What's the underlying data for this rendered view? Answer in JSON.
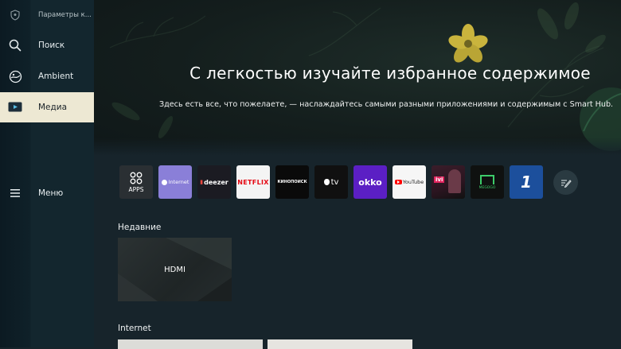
{
  "sidebar": {
    "items": [
      {
        "label": "Параметры к...",
        "icon": "shield-icon"
      },
      {
        "label": "Поиск",
        "icon": "search-icon"
      },
      {
        "label": "Ambient",
        "icon": "ambient-icon"
      },
      {
        "label": "Медиа",
        "icon": "media-icon",
        "active": true
      },
      {
        "label": "Меню",
        "icon": "menu-icon"
      }
    ]
  },
  "hero": {
    "title": "С легкостью изучайте избранное содержимое",
    "subtitle": "Здесь есть все, что пожелаете, — наслаждайтесь самыми разными приложениями и содержимым с Smart Hub."
  },
  "apps": [
    {
      "label": "APPS",
      "icon": "apps-grid-icon",
      "bg": "#2a2f33"
    },
    {
      "label": "Internet",
      "icon": "internet-icon",
      "bg": "#8a7fd8"
    },
    {
      "label": "deezer",
      "icon": "deezer-icon",
      "bg": "#1b1b22"
    },
    {
      "label": "NETFLIX",
      "icon": "netflix-icon",
      "bg": "#f4f4f4"
    },
    {
      "label": "КИНОПОИСК",
      "icon": "kinopoisk-icon",
      "bg": "#0a0a0a"
    },
    {
      "label": "tv",
      "icon": "apple-tv-icon",
      "bg": "#101010"
    },
    {
      "label": "okko",
      "icon": "okko-icon",
      "bg": "#5b1fc4"
    },
    {
      "label": "YouTube",
      "icon": "youtube-icon",
      "bg": "#f6f6f6"
    },
    {
      "label": "ivi",
      "icon": "ivi-icon",
      "bg": "#2b1520"
    },
    {
      "label": "MEGOGO",
      "icon": "megogo-icon",
      "bg": "#0f1110"
    },
    {
      "label": "1",
      "icon": "channel-one-icon",
      "bg": "#1c4f9c"
    }
  ],
  "sections": {
    "recent": {
      "title": "Недавние",
      "card_label": "HDMI"
    },
    "internet": {
      "title": "Internet"
    }
  },
  "colors": {
    "active_bg": "#ede8d3",
    "accent_yellow": "#d8c24a",
    "background": "#17242b"
  }
}
